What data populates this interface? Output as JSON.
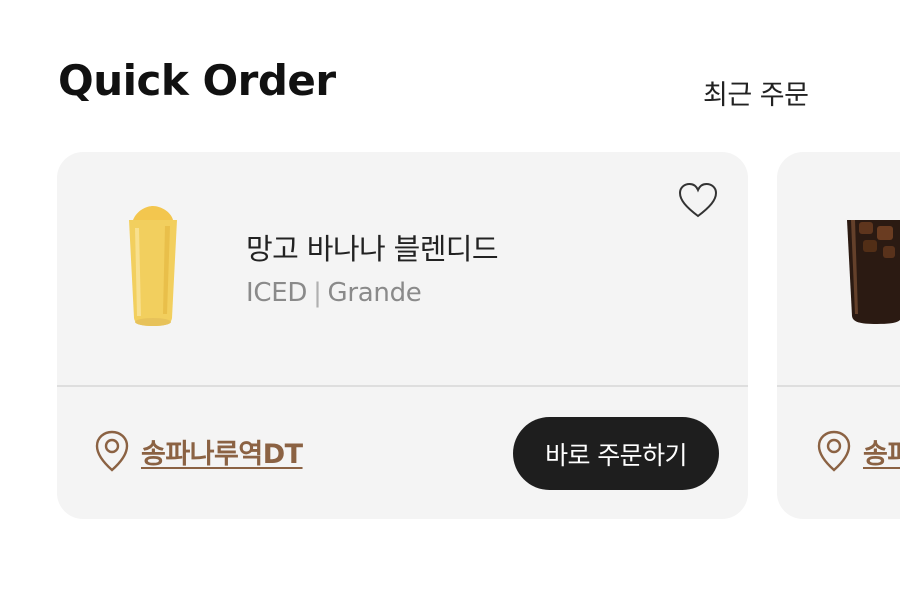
{
  "header": {
    "title": "Quick Order",
    "recent_link": "최근 주문"
  },
  "cards": [
    {
      "product_name": "망고 바나나 블렌디드",
      "temperature": "ICED",
      "size": "Grande",
      "store": "송파나루역DT",
      "order_button": "바로 주문하기",
      "image": "mango-banana-blended-icon"
    },
    {
      "store": "송파",
      "image": "iced-coffee-icon"
    }
  ],
  "colors": {
    "store_link": "#8b6243",
    "order_button_bg": "#1e1e1e",
    "card_bg": "#f4f4f4"
  }
}
